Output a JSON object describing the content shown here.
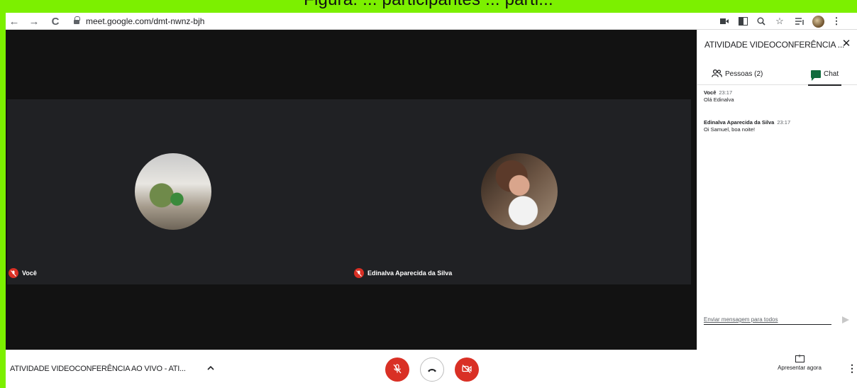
{
  "caption_partial": "Figura: ... participantes ... parti...",
  "browser": {
    "url": "meet.google.com/dmt-nwnz-bjh",
    "back_icon": "arrow-left-icon",
    "forward_icon": "arrow-right-icon",
    "reload_icon": "reload-icon"
  },
  "participants": [
    {
      "name": "Você"
    },
    {
      "name": "Edinalva Aparecida da Silva"
    }
  ],
  "panel": {
    "title": "ATIVIDADE VIDEOCONFERÊNCIA ...",
    "tab_people": "Pessoas (2)",
    "tab_chat": "Chat",
    "messages": [
      {
        "sender": "Você",
        "time": "23:17",
        "text": "Olá Edinalva"
      },
      {
        "sender": "Edinalva Aparecida da Silva",
        "time": "23:17",
        "text": "Oi Samuel, boa noite!"
      }
    ],
    "input_placeholder": "Enviar mensagem para todos"
  },
  "bottom": {
    "meeting_name": "ATIVIDADE VIDEOCONFERÊNCIA AO VIVO - ATI...",
    "present_label": "Apresentar agora"
  },
  "colors": {
    "background_border": "#7cf000",
    "mute_red": "#d93025",
    "chat_green": "#0f6b3c"
  }
}
